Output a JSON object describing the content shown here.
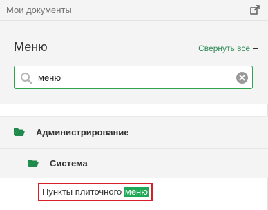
{
  "topbar": {
    "title": "Мои документы",
    "icon": "expand-window-icon"
  },
  "menu": {
    "title": "Меню",
    "collapse_all_label": "Свернуть все",
    "accent_color": "#2e8b57"
  },
  "search": {
    "value": "меню",
    "placeholder": "",
    "border_color": "#2fa34f"
  },
  "tree": {
    "level1": {
      "label": "Администрирование",
      "icon": "folder-open-icon"
    },
    "level2": {
      "label": "Система",
      "icon": "folder-open-icon"
    },
    "leaf": {
      "prefix": "Пункты плиточного ",
      "match": "меню",
      "highlight_color": "#1fa855",
      "outline_color": "#d81f2a"
    }
  }
}
